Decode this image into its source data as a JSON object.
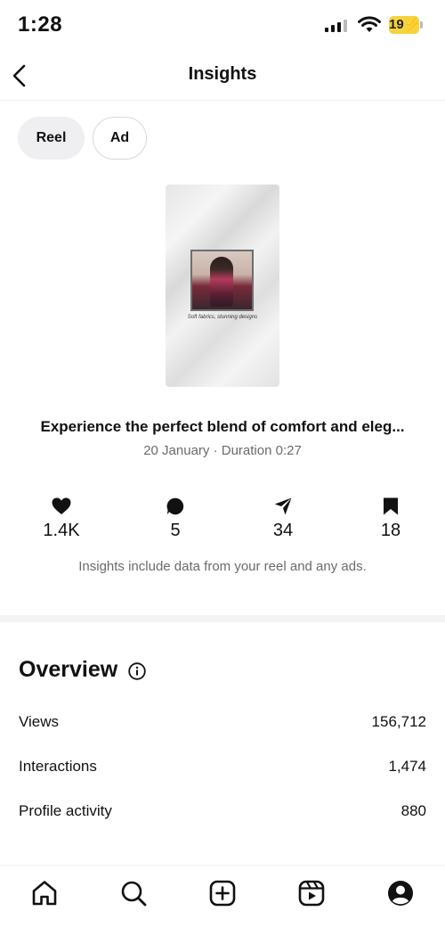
{
  "status_bar": {
    "time": "1:28",
    "battery": "19"
  },
  "header": {
    "title": "Insights",
    "back_icon": "chevron-left-icon"
  },
  "tabs": [
    {
      "label": "Reel",
      "selected": true
    },
    {
      "label": "Ad",
      "selected": false
    }
  ],
  "reel": {
    "thumbnail_caption": "Soft fabrics, stunning designs",
    "title": "Experience the perfect blend of comfort and eleg...",
    "meta": "20 January · Duration 0:27"
  },
  "stats": [
    {
      "icon": "heart-icon",
      "value": "1.4K"
    },
    {
      "icon": "comment-icon",
      "value": "5"
    },
    {
      "icon": "share-icon",
      "value": "34"
    },
    {
      "icon": "bookmark-icon",
      "value": "18"
    }
  ],
  "note": "Insights include data from your reel and any ads.",
  "overview": {
    "title": "Overview",
    "rows": [
      {
        "label": "Views",
        "value": "156,712"
      },
      {
        "label": "Interactions",
        "value": "1,474"
      },
      {
        "label": "Profile activity",
        "value": "880"
      }
    ]
  },
  "bottom_nav": [
    "home-icon",
    "search-icon",
    "create-icon",
    "reels-icon",
    "profile-icon"
  ],
  "colors": {
    "battery": "#f6d33c",
    "chip_selected_bg": "#efeff1",
    "muted_text": "#6b6b6b"
  }
}
